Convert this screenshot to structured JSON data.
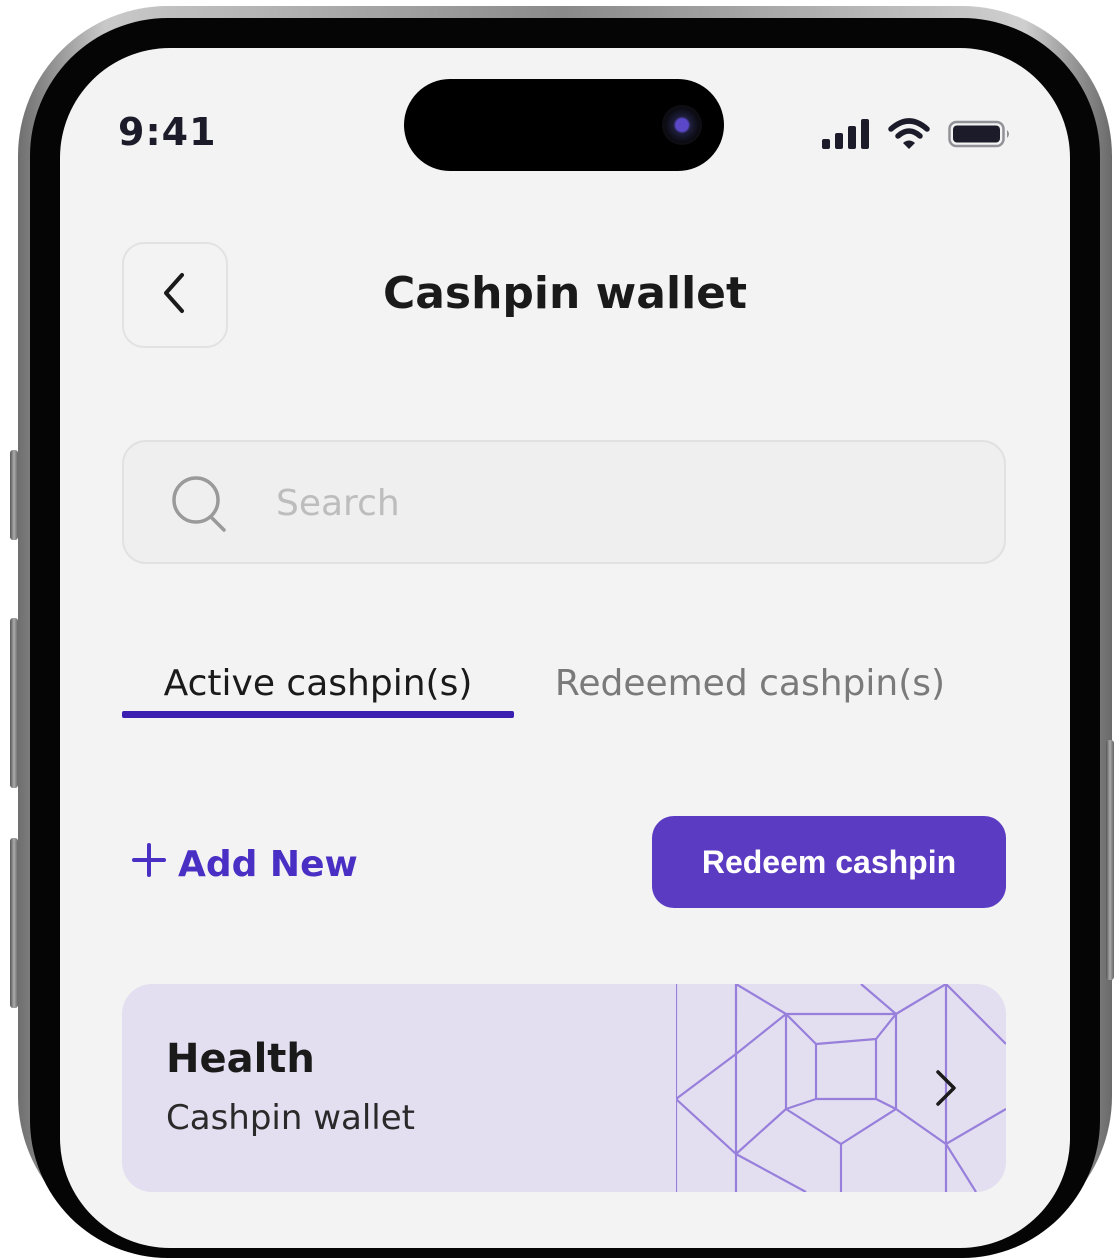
{
  "status_bar": {
    "time": "9:41",
    "icons": [
      "signal-icon",
      "wifi-icon",
      "battery-icon"
    ]
  },
  "header": {
    "back_icon": "chevron-left-icon",
    "title": "Cashpin wallet"
  },
  "search": {
    "placeholder": "Search",
    "value": "",
    "icon": "search-icon"
  },
  "tabs": [
    {
      "label": "Active cashpin(s)",
      "active": true
    },
    {
      "label": "Redeemed cashpin(s)",
      "active": false
    }
  ],
  "actions": {
    "add_new_label": "Add New",
    "add_new_icon": "plus-icon",
    "redeem_label": "Redeem cashpin"
  },
  "cards": [
    {
      "title": "Health",
      "subtitle": "Cashpin wallet",
      "icon": "chevron-right-icon"
    }
  ],
  "colors": {
    "accent": "#5b3bc2",
    "tab_underline": "#3a1fb0",
    "link": "#4a2fc4",
    "card_bg": "#e3dff0",
    "pattern_stroke": "#8a6fd8",
    "screen_bg": "#f3f3f3"
  }
}
